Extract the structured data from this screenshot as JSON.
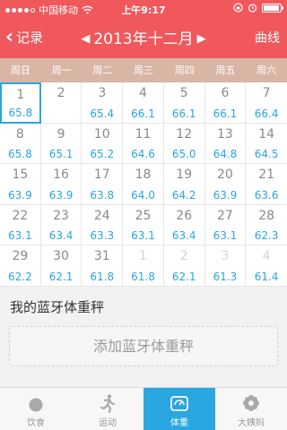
{
  "status": {
    "carrier": "中国移动",
    "time": "上午9:17"
  },
  "nav": {
    "back_label": "记录",
    "month_title": "2013年十二月",
    "right_label": "曲线"
  },
  "week_days": [
    "周日",
    "周一",
    "周二",
    "周三",
    "周四",
    "周五",
    "周六"
  ],
  "calendar": {
    "cells": [
      {
        "day": "1",
        "weight": "65.8",
        "other": false
      },
      {
        "day": "2",
        "weight": "",
        "other": false
      },
      {
        "day": "3",
        "weight": "65.4",
        "other": false
      },
      {
        "day": "4",
        "weight": "66.1",
        "other": false
      },
      {
        "day": "5",
        "weight": "66.1",
        "other": false
      },
      {
        "day": "6",
        "weight": "66.1",
        "other": false
      },
      {
        "day": "7",
        "weight": "66.4",
        "other": false
      },
      {
        "day": "8",
        "weight": "65.8",
        "other": false
      },
      {
        "day": "9",
        "weight": "65.1",
        "other": false
      },
      {
        "day": "10",
        "weight": "65.2",
        "other": false
      },
      {
        "day": "11",
        "weight": "64.6",
        "other": false
      },
      {
        "day": "12",
        "weight": "65.0",
        "other": false
      },
      {
        "day": "13",
        "weight": "64.8",
        "other": false
      },
      {
        "day": "14",
        "weight": "64.5",
        "other": false
      },
      {
        "day": "15",
        "weight": "63.9",
        "other": false
      },
      {
        "day": "16",
        "weight": "63.9",
        "other": false
      },
      {
        "day": "17",
        "weight": "63.8",
        "other": false
      },
      {
        "day": "18",
        "weight": "64.0",
        "other": false
      },
      {
        "day": "19",
        "weight": "64.2",
        "other": false
      },
      {
        "day": "20",
        "weight": "63.9",
        "other": false
      },
      {
        "day": "21",
        "weight": "63.6",
        "other": false
      },
      {
        "day": "22",
        "weight": "63.1",
        "other": false
      },
      {
        "day": "23",
        "weight": "63.4",
        "other": false
      },
      {
        "day": "24",
        "weight": "63.3",
        "other": false
      },
      {
        "day": "25",
        "weight": "63.1",
        "other": false
      },
      {
        "day": "26",
        "weight": "63.4",
        "other": false
      },
      {
        "day": "27",
        "weight": "63.1",
        "other": false
      },
      {
        "day": "28",
        "weight": "62.3",
        "other": false
      },
      {
        "day": "29",
        "weight": "62.2",
        "other": false
      },
      {
        "day": "30",
        "weight": "62.1",
        "other": false
      },
      {
        "day": "31",
        "weight": "61.8",
        "other": false
      },
      {
        "day": "1",
        "weight": "61.8",
        "other": true
      },
      {
        "day": "2",
        "weight": "62.1",
        "other": true
      },
      {
        "day": "3",
        "weight": "61.3",
        "other": true
      },
      {
        "day": "4",
        "weight": "61.4",
        "other": true
      }
    ]
  },
  "scale": {
    "title": "我的蓝牙体重秤",
    "add_label": "添加蓝牙体重秤"
  },
  "tabs": [
    {
      "label": "饮食",
      "icon": "tomato-icon",
      "active": false
    },
    {
      "label": "运动",
      "icon": "running-icon",
      "active": false
    },
    {
      "label": "体重",
      "icon": "scale-gauge-icon",
      "active": true
    },
    {
      "label": "大姨妈",
      "icon": "flower-icon",
      "active": false
    }
  ],
  "colors": {
    "accent": "#f0585b",
    "weight_text": "#2aa6e0",
    "week_header": "#d9b5a5"
  }
}
